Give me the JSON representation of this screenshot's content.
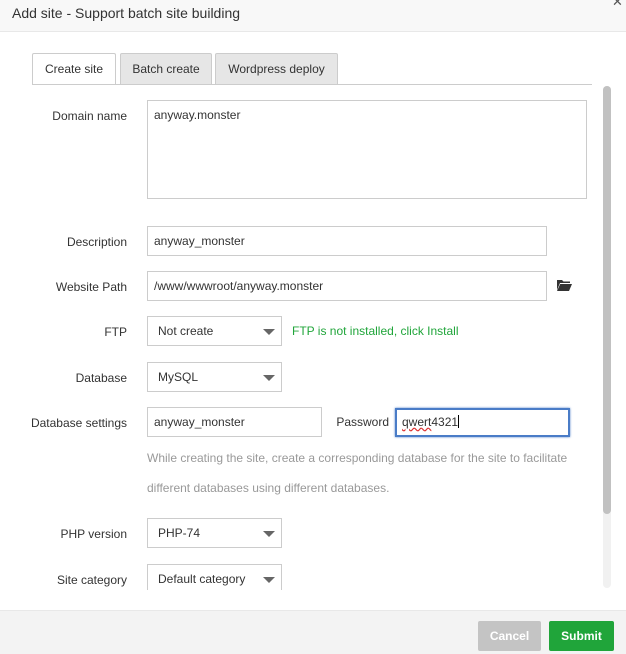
{
  "dialog": {
    "title": "Add site - Support batch site building"
  },
  "tabs": [
    {
      "label": "Create site",
      "active": true
    },
    {
      "label": "Batch create",
      "active": false
    },
    {
      "label": "Wordpress deploy",
      "active": false
    }
  ],
  "form": {
    "domain_label": "Domain name",
    "domain_value": "anyway.monster",
    "description_label": "Description",
    "description_value": "anyway_monster",
    "path_label": "Website Path",
    "path_value": "/www/wwwroot/anyway.monster",
    "ftp_label": "FTP",
    "ftp_value": "Not create",
    "ftp_note": "FTP is not installed, click Install",
    "database_label": "Database",
    "database_value": "MySQL",
    "dbsettings_label": "Database settings",
    "db_name_value": "anyway_monster",
    "password_label": "Password",
    "password_prefix": "qwert",
    "password_suffix": "4321",
    "db_hint_line1": "While creating the site, create a corresponding database for the site to facilitate",
    "db_hint_line2": "different databases using different databases.",
    "php_label": "PHP version",
    "php_value": "PHP-74",
    "category_label": "Site category",
    "category_value": "Default category"
  },
  "footer": {
    "cancel_label": "Cancel",
    "submit_label": "Submit"
  },
  "colors": {
    "accent": "#20a53a",
    "focus": "#4a7cc7"
  },
  "icons": {
    "close": "close-icon",
    "folder": "folder-icon",
    "dropdown": "chevron-down-icon"
  }
}
